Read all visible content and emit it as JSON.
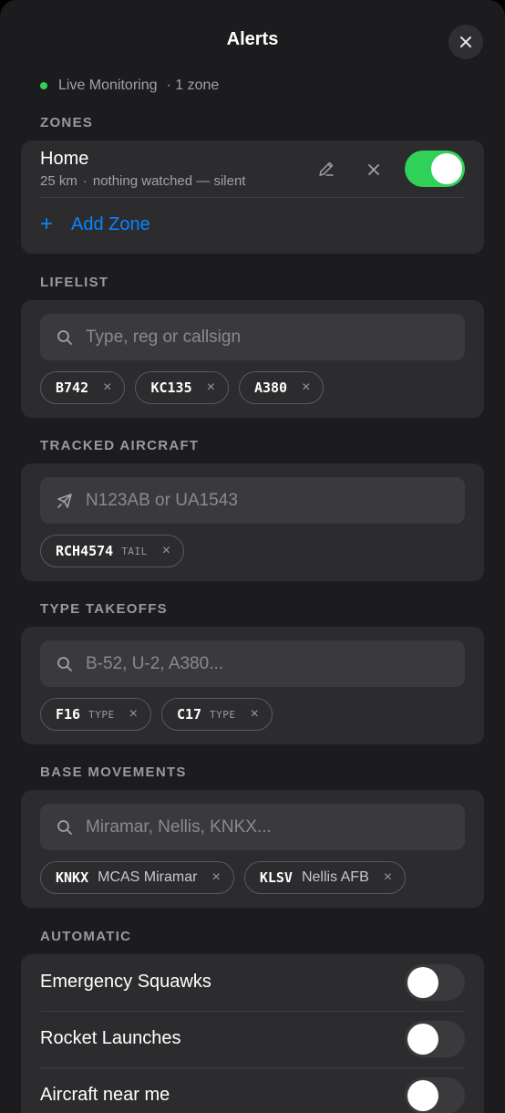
{
  "header": {
    "title": "Alerts"
  },
  "status": {
    "text": "Live Monitoring",
    "zones": "· 1 zone"
  },
  "zones": {
    "label": "ZONES",
    "items": [
      {
        "name": "Home",
        "radius": "25 km",
        "detail": "nothing watched — silent",
        "enabled": true
      }
    ],
    "add_label": "Add Zone"
  },
  "lifelist": {
    "label": "LIFELIST",
    "placeholder": "Type, reg or callsign",
    "chips": [
      {
        "code": "B742"
      },
      {
        "code": "KC135"
      },
      {
        "code": "A380"
      }
    ]
  },
  "tracked": {
    "label": "TRACKED AIRCRAFT",
    "placeholder": "N123AB or UA1543",
    "chips": [
      {
        "code": "RCH4574",
        "tag": "TAIL"
      }
    ]
  },
  "takeoffs": {
    "label": "TYPE TAKEOFFS",
    "placeholder": "B-52, U-2, A380...",
    "chips": [
      {
        "code": "F16",
        "tag": "TYPE"
      },
      {
        "code": "C17",
        "tag": "TYPE"
      }
    ]
  },
  "bases": {
    "label": "BASE MOVEMENTS",
    "placeholder": "Miramar, Nellis, KNKX...",
    "chips": [
      {
        "code": "KNKX",
        "desc": "MCAS Miramar"
      },
      {
        "code": "KLSV",
        "desc": "Nellis AFB"
      }
    ]
  },
  "automatic": {
    "label": "AUTOMATIC",
    "items": [
      {
        "label": "Emergency Squawks",
        "enabled": false
      },
      {
        "label": "Rocket Launches",
        "enabled": false
      },
      {
        "label": "Aircraft near me",
        "enabled": false
      }
    ]
  },
  "glyphs": {
    "remove": "×",
    "plus": "+",
    "separator": "·"
  },
  "colors": {
    "accent": "#0a84ff",
    "toggle_on": "#30d158",
    "live_dot": "#30d158",
    "background": "#1c1c1e",
    "card": "#2c2c2e"
  }
}
